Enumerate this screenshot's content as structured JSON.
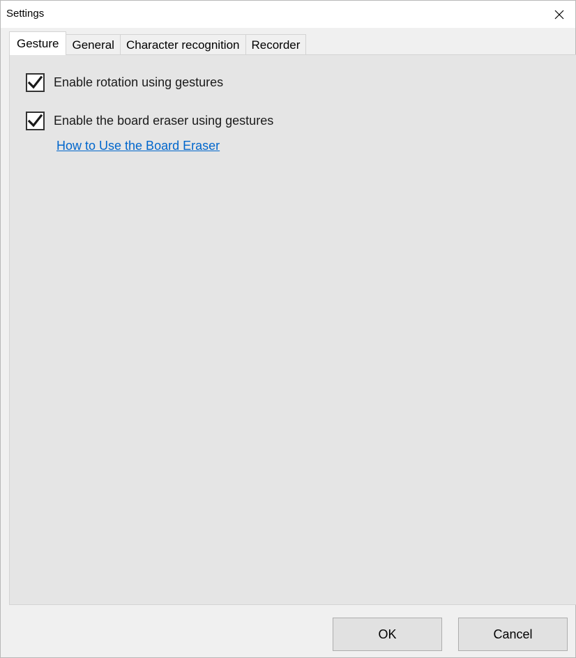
{
  "window": {
    "title": "Settings"
  },
  "tabs": [
    {
      "label": "Gesture",
      "active": true
    },
    {
      "label": "General",
      "active": false
    },
    {
      "label": "Character recognition",
      "active": false
    },
    {
      "label": "Recorder",
      "active": false
    }
  ],
  "gesture": {
    "rotation_label": "Enable rotation using gestures",
    "rotation_checked": true,
    "eraser_label": "Enable the board eraser using gestures",
    "eraser_checked": true,
    "help_link": "How to Use the Board Eraser"
  },
  "buttons": {
    "ok_label": "OK",
    "cancel_label": "Cancel"
  },
  "icons": {
    "close": "close-icon",
    "check": "checkmark-icon"
  },
  "colors": {
    "link": "#0066cc",
    "panel": "#e5e5e5",
    "window": "#f0f0f0"
  }
}
